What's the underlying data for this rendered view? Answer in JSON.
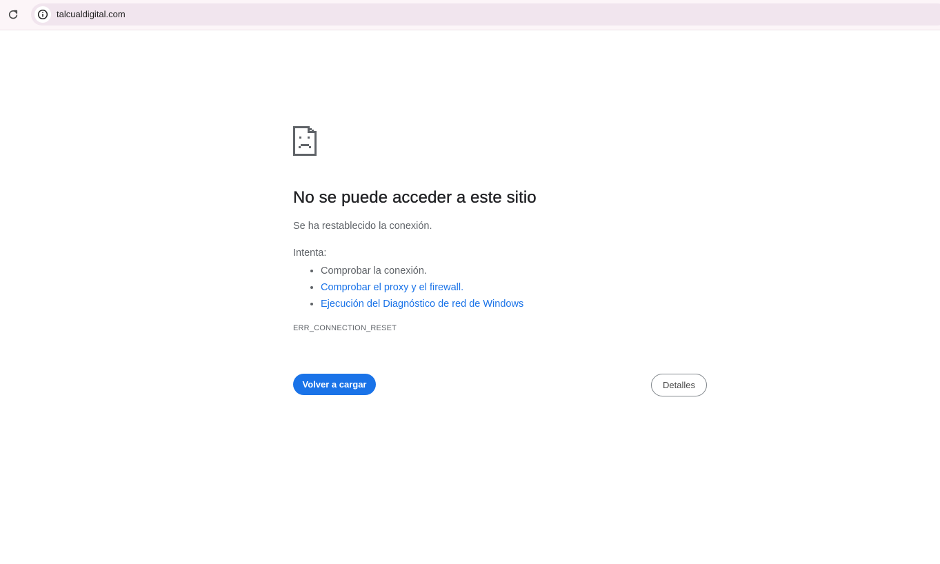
{
  "toolbar": {
    "reload_icon": "reload-icon",
    "site_info_icon": "info-icon",
    "url": "talcualdigital.com"
  },
  "error_page": {
    "icon": "sad-page-icon",
    "heading": "No se puede acceder a este sitio",
    "summary": "Se ha restablecido la conexión.",
    "try_label": "Intenta:",
    "suggestions": [
      {
        "text": "Comprobar la conexión.",
        "is_link": false
      },
      {
        "text": "Comprobar el proxy y el firewall.",
        "is_link": true
      },
      {
        "text": "Ejecución del Diagnóstico de red de Windows",
        "is_link": true
      }
    ],
    "error_code": "ERR_CONNECTION_RESET",
    "reload_button_label": "Volver a cargar",
    "details_button_label": "Detalles"
  },
  "colors": {
    "accent": "#1a73e8",
    "text_primary": "#202124",
    "text_secondary": "#5f6368",
    "omnibox_bg": "#f1e5ee",
    "toolbar_bg": "#fcf5f8"
  }
}
